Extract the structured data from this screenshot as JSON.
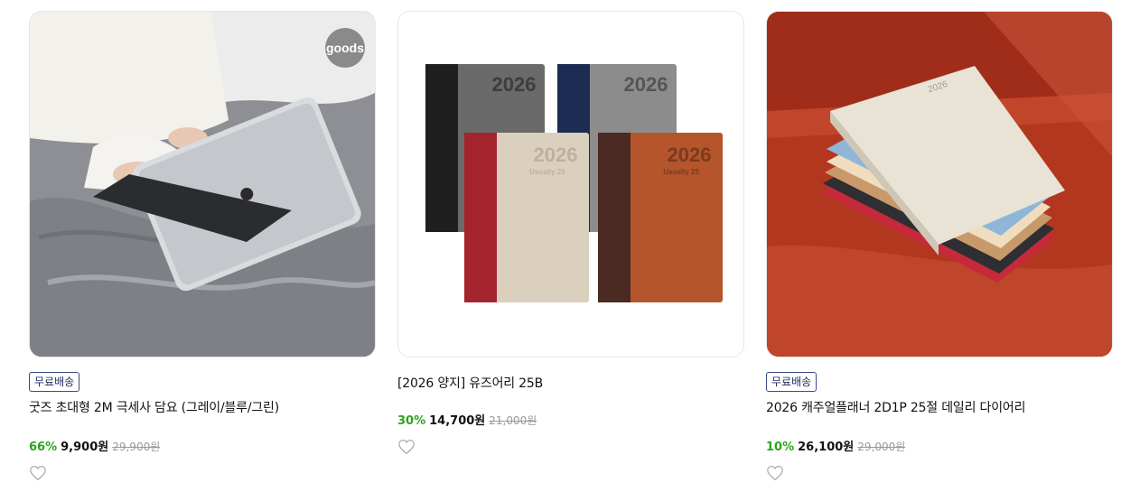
{
  "products": [
    {
      "badge": "무료배송",
      "title": "굿즈 초대형 2M 극세사 담요 (그레이/블루/그린)",
      "discount": "66%",
      "price": "9,900원",
      "original_price": "29,900원",
      "watermark": "goods",
      "image": "person-with-tablet-under-blanket"
    },
    {
      "title": "[2026 양지] 유즈어리 25B",
      "discount": "30%",
      "price": "14,700원",
      "original_price": "21,000원",
      "image": "four-2026-diaries",
      "cover_text": "2026",
      "cover_subtext": "Usually 25"
    },
    {
      "badge": "무료배송",
      "title": "2026 캐주얼플래너 2D1P 25절 데일리 다이어리",
      "discount": "10%",
      "price": "26,100원",
      "original_price": "29,000원",
      "image": "stack-of-planners-on-red-sofa",
      "cover_text": "2026"
    }
  ],
  "colors": {
    "discount": "#2ba41c",
    "badge_border": "#3a4a8a"
  },
  "icons": {
    "wishlist": "heart-outline-icon"
  }
}
